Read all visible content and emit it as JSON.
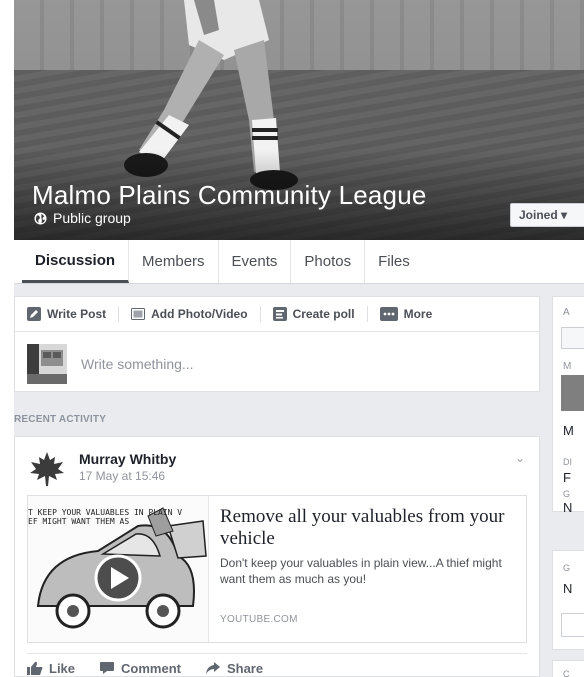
{
  "group": {
    "title": "Malmo Plains Community League",
    "privacy": "Public group",
    "joined_label": "Joined ▾"
  },
  "tabs": [
    {
      "label": "Discussion",
      "active": true
    },
    {
      "label": "Members"
    },
    {
      "label": "Events"
    },
    {
      "label": "Photos"
    },
    {
      "label": "Files"
    }
  ],
  "composer": {
    "tools": [
      {
        "label": "Write Post",
        "icon": "pencil-icon"
      },
      {
        "label": "Add Photo/Video",
        "icon": "photo-icon"
      },
      {
        "label": "Create poll",
        "icon": "poll-icon"
      },
      {
        "label": "More",
        "icon": "more-icon"
      }
    ],
    "placeholder": "Write something..."
  },
  "recent_activity_label": "RECENT ACTIVITY",
  "post": {
    "author": "Murray Whitby",
    "time": "17 May at 15:46",
    "link": {
      "thumb_caption": "T KEEP YOUR VALUABLES IN PLAIN V\nEF MIGHT WANT THEM AS",
      "title": "Remove all your valuables from your vehicle",
      "description": "Don't keep your valuables in plain view...A thief might want them as much as you!",
      "domain": "YOUTUBE.COM"
    },
    "actions": [
      "Like",
      "Comment",
      "Share"
    ]
  },
  "sidebar_fragments": {
    "a1": "A",
    "m1": "M",
    "m2": "M",
    "d1": "DI",
    "f1": "F",
    "g1": "G",
    "n1": "N",
    "g2": "G",
    "n2": "N",
    "c1": "C"
  },
  "colors": {
    "page_bg": "#e9ebee",
    "card_bg": "#ffffff",
    "text_primary": "#1d2129",
    "text_muted": "#90949c"
  }
}
